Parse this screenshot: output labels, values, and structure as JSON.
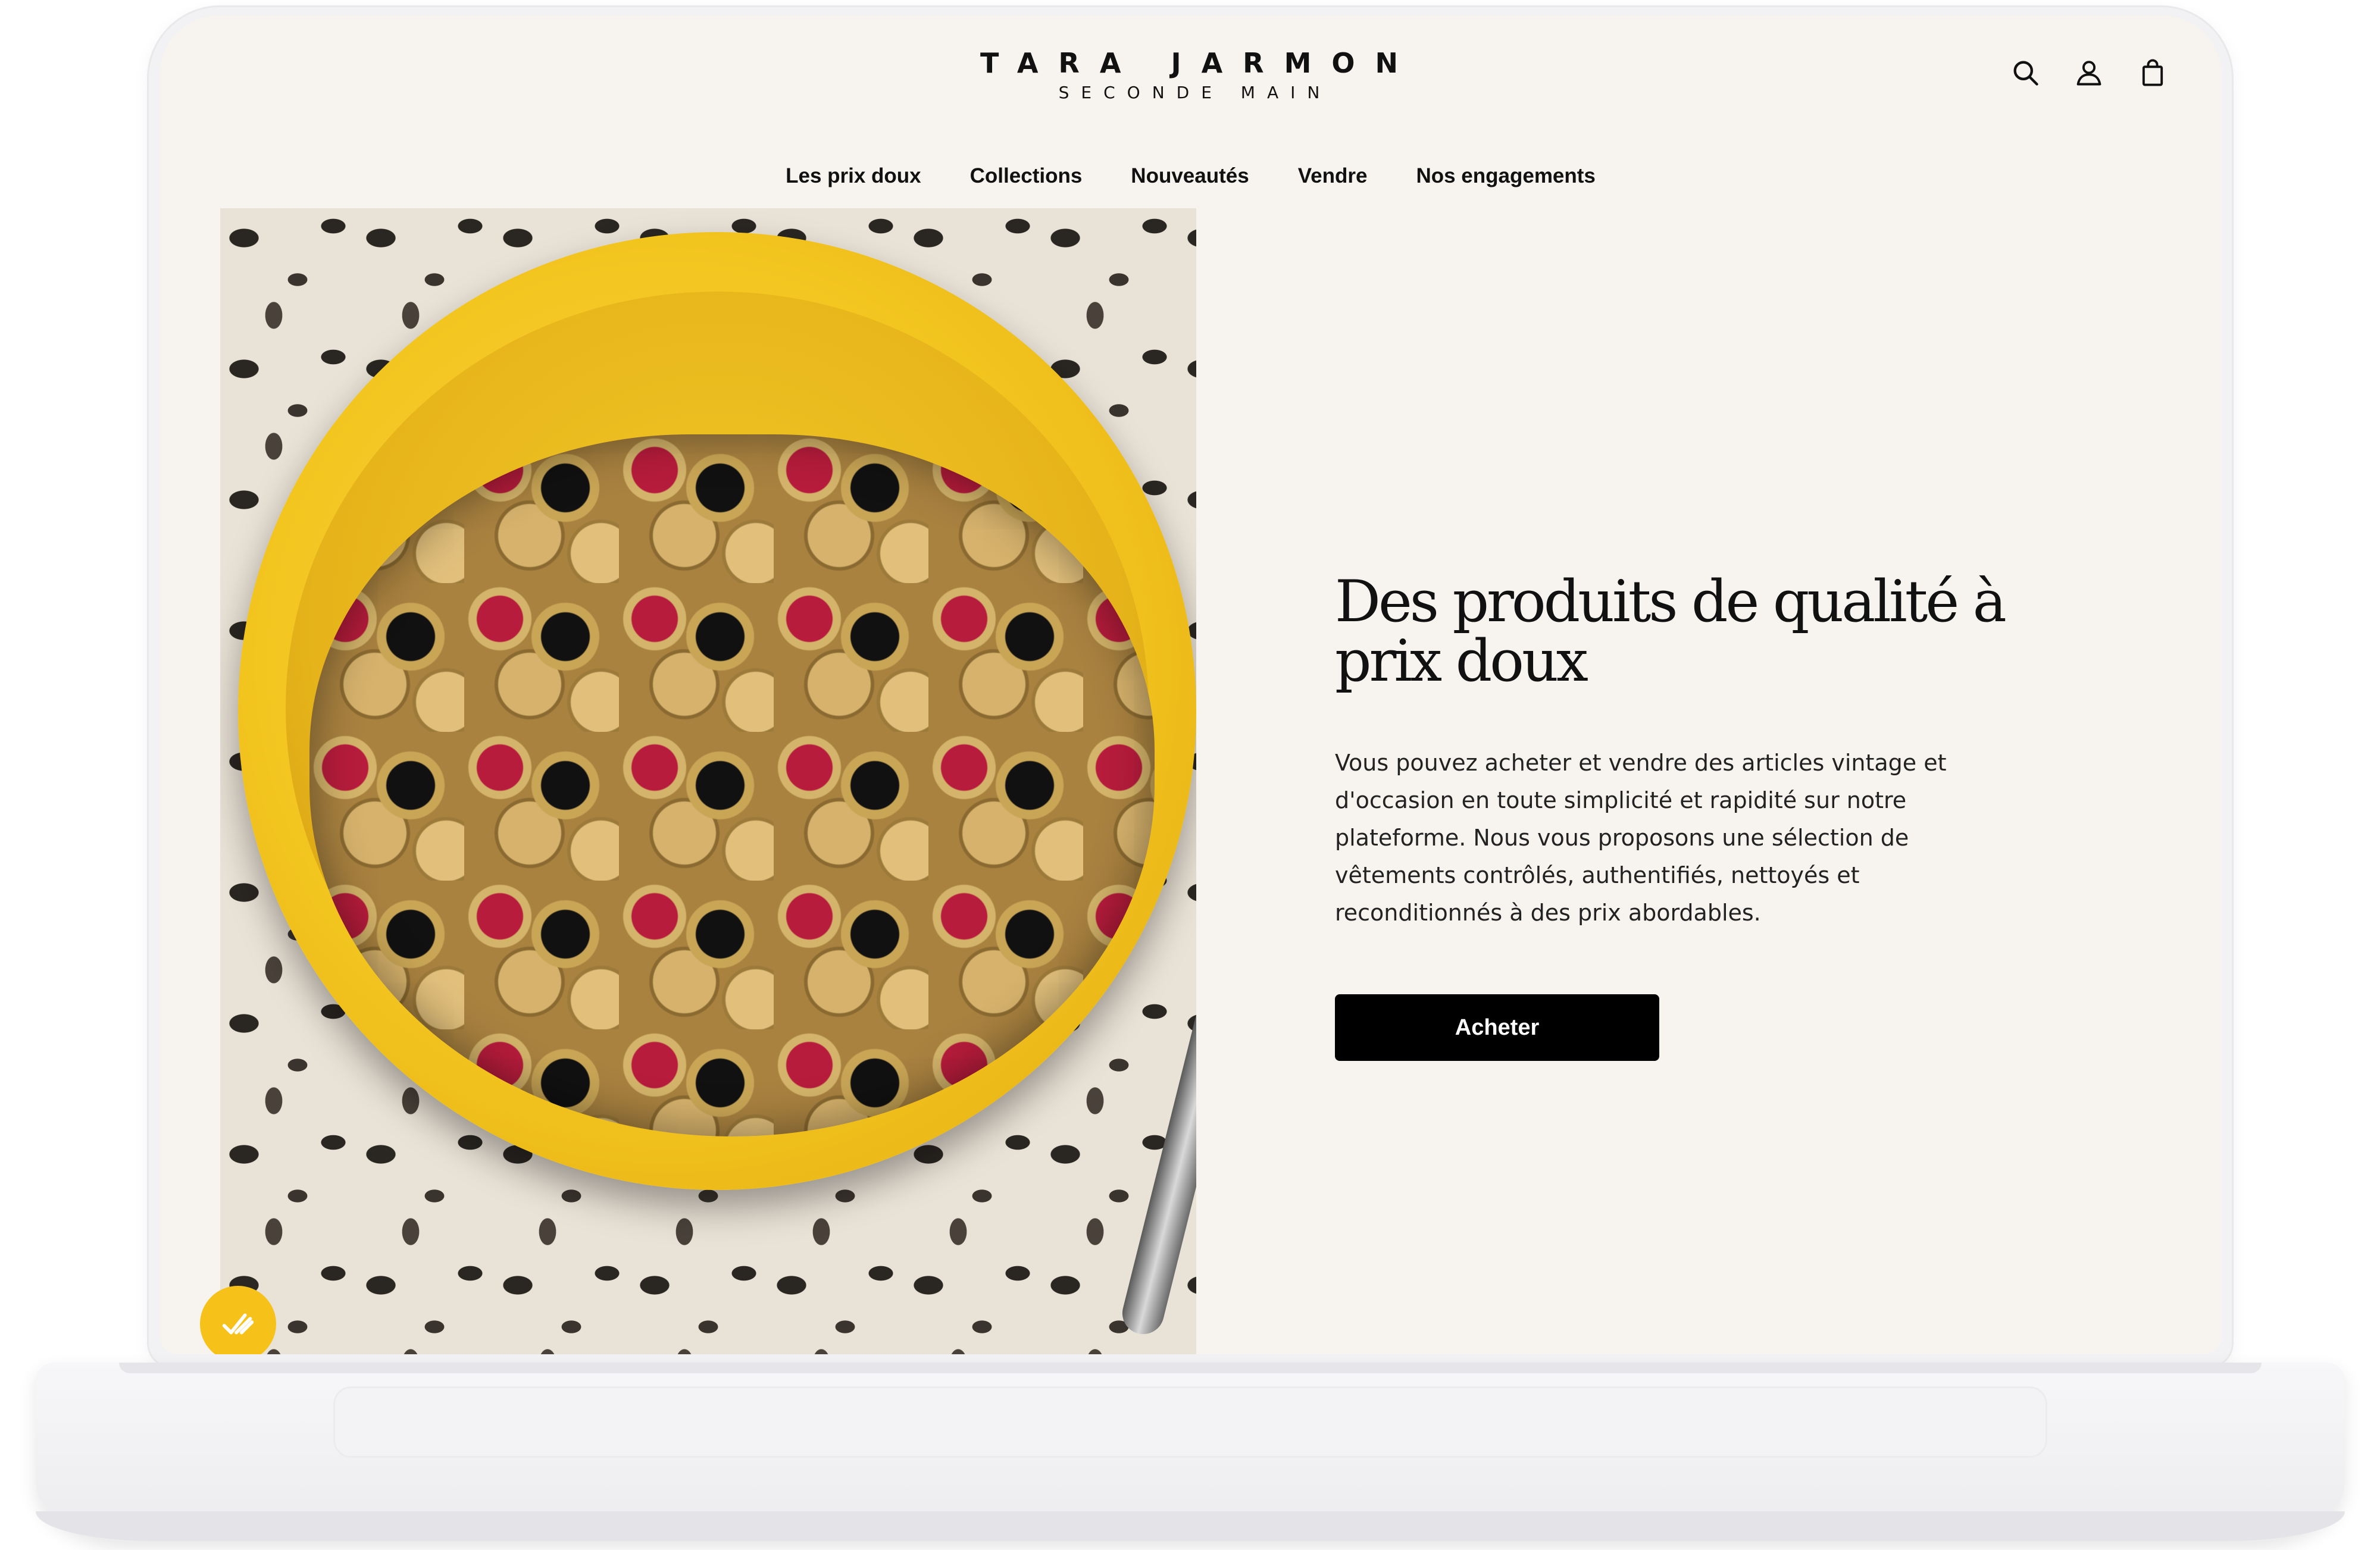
{
  "brand": {
    "name": "TARA JARMON",
    "tagline": "SECONDE MAIN"
  },
  "header": {
    "icons": [
      "search-icon",
      "account-icon",
      "bag-icon"
    ]
  },
  "nav": {
    "items": [
      {
        "label": "Les prix doux"
      },
      {
        "label": "Collections"
      },
      {
        "label": "Nouveautés"
      },
      {
        "label": "Vendre"
      },
      {
        "label": "Nos engagements"
      }
    ]
  },
  "hero": {
    "headline": "Des produits de qualité à prix doux",
    "body": "Vous pouvez acheter et vendre des articles vintage et d'occasion en toute simplicité et rapidité sur notre plateforme. Nous vous proposons une sélection de vêtements contrôlés, authentifiés, nettoyés et reconditionnés à des prix abordables.",
    "cta_label": "Acheter",
    "image_icon": "coins-bowl-photo"
  },
  "chat": {
    "icon": "chat-badge-icon"
  },
  "colors": {
    "page_background": "#f7f4ef",
    "accent_yellow": "#f6c21a",
    "button_black": "#000000"
  }
}
